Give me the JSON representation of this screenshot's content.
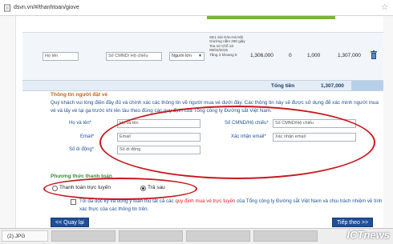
{
  "browser": {
    "url": "dsvn.vn/#/thanhtoan/giove"
  },
  "ticket": {
    "name_placeholder": "Họ tên",
    "id_placeholder": "Số CMND/ Hộ chiếu",
    "type_value": "Người lớn",
    "info": [
      "SE1 Sài Gòn-Hà Nội",
      "Giường nằm 280 giây",
      "Toa 10 Chỗ 18",
      "06/02/2015",
      "Tầng 3 khoang 5"
    ],
    "price": "1,306,000",
    "discount": "0",
    "insurance": "1,000",
    "amount": "1,307,000"
  },
  "total": {
    "label": "Tổng tiền",
    "value": "1,307,000"
  },
  "buyer": {
    "section_title": "Thông tin người đặt vé",
    "intro": "Quý khách vui lòng điền đầy đủ và chính xác các thông tin về người mua vé dưới đây. Các thông tin này sẽ được sử dụng để xác minh người mua vé và lấy vé tại ga trước khi lên tàu theo đúng các quy định của Tổng công ty Đường sắt Việt Nam.",
    "name_label": "Họ và tên*",
    "name_placeholder": "Họ và tên",
    "id_label": "Số CMND/Hộ chiếu*",
    "id_placeholder": "Số CMND/Hộ chiếu",
    "email_label": "Email*",
    "email_placeholder": "Email",
    "confirm_label": "Xác nhận email*",
    "confirm_placeholder": "Xác nhận email",
    "phone_label": "Số di động*",
    "phone_placeholder": "Số di động"
  },
  "payment": {
    "title": "Phương thức thanh toán",
    "online_label": "Thanh toán trực tuyến",
    "later_label": "Trả sau",
    "selected": "later"
  },
  "agreement": {
    "text_before": "Tôi đã đọc kỹ và đồng ý tuân thủ tất cả các ",
    "link_text": "quy định mua vé trực tuyến",
    "text_after": " của Tổng công ty Đường sắt Việt Nam và chịu trách nhiệm về tính xác thực của các thông tin trên."
  },
  "nav": {
    "back_label": "<< Quay lại",
    "next_label": "Tiếp theo >>"
  },
  "downloads": {
    "file_name": "(2).JPG"
  },
  "watermark": "ICTnews",
  "colors": {
    "accent_blue": "#1f4f9a",
    "oval_red": "#c8161d",
    "section_orange": "#c8651a",
    "payment_green": "#3a8a3a"
  }
}
